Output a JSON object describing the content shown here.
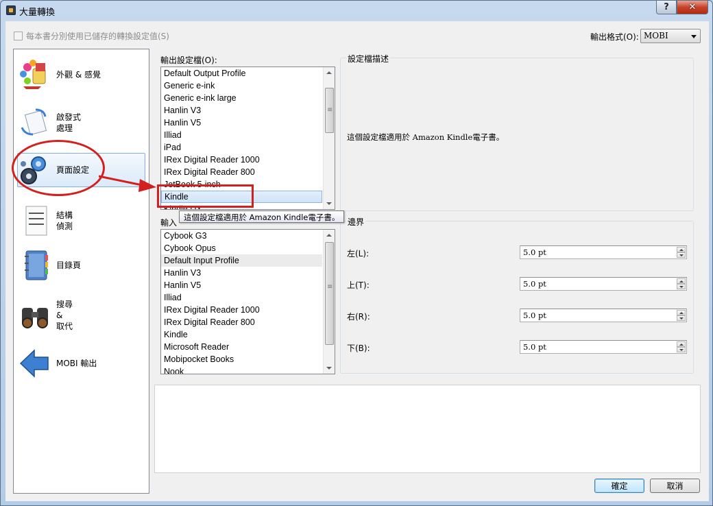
{
  "window": {
    "title": "大量轉換",
    "help_label": "?",
    "close_label": "✕"
  },
  "top": {
    "per_book_checkbox_label": "每本書分別使用已儲存的轉換設定值(S)",
    "output_format_label": "輸出格式(O):",
    "output_format_value": "MOBI"
  },
  "sidebar": {
    "items": [
      {
        "label": "外觀 & 感覺",
        "icon": "paint-palette-icon"
      },
      {
        "label": "啟發式\n處理",
        "icon": "document-refresh-icon"
      },
      {
        "label": "頁面設定",
        "icon": "gears-icon"
      },
      {
        "label": "結構\n偵測",
        "icon": "document-lines-icon"
      },
      {
        "label": "目錄頁",
        "icon": "notebook-icon"
      },
      {
        "label": "搜尋\n&\n取代",
        "icon": "binoculars-icon"
      },
      {
        "label": "MOBI 輸出",
        "icon": "back-arrow-icon"
      }
    ],
    "selected_index": 2
  },
  "output_profile": {
    "label": "輸出設定檔(O):",
    "items": [
      "Default Output Profile",
      "Generic e-ink",
      "Generic e-ink large",
      "Hanlin V3",
      "Hanlin V5",
      "Illiad",
      "iPad",
      "IRex Digital Reader 1000",
      "IRex Digital Reader 800",
      "JetBook 5-inch",
      "Kindle",
      "Kindle DX"
    ],
    "selected": "Kindle"
  },
  "input_profile": {
    "label": "輸入",
    "items": [
      "Cybook G3",
      "Cybook Opus",
      "Default Input Profile",
      "Hanlin V3",
      "Hanlin V5",
      "Illiad",
      "IRex Digital Reader 1000",
      "IRex Digital Reader 800",
      "Kindle",
      "Microsoft Reader",
      "Mobipocket Books",
      "Nook"
    ],
    "highlighted": "Default Input Profile"
  },
  "profile_description": {
    "title": "設定檔描述",
    "text": "這個設定檔適用於 Amazon Kindle電子書。"
  },
  "tooltip": {
    "text": "這個設定檔適用於 Amazon Kindle電子書。"
  },
  "margins": {
    "title": "邊界",
    "left": {
      "label": "左(L):",
      "value": "5.0 pt"
    },
    "top": {
      "label": "上(T):",
      "value": "5.0 pt"
    },
    "right": {
      "label": "右(R):",
      "value": "5.0 pt"
    },
    "bottom": {
      "label": "下(B):",
      "value": "5.0 pt"
    }
  },
  "buttons": {
    "ok": "確定",
    "cancel": "取消"
  },
  "colors": {
    "annotation_red": "#d21f1f",
    "selection_blue": "#cfe3f8"
  }
}
